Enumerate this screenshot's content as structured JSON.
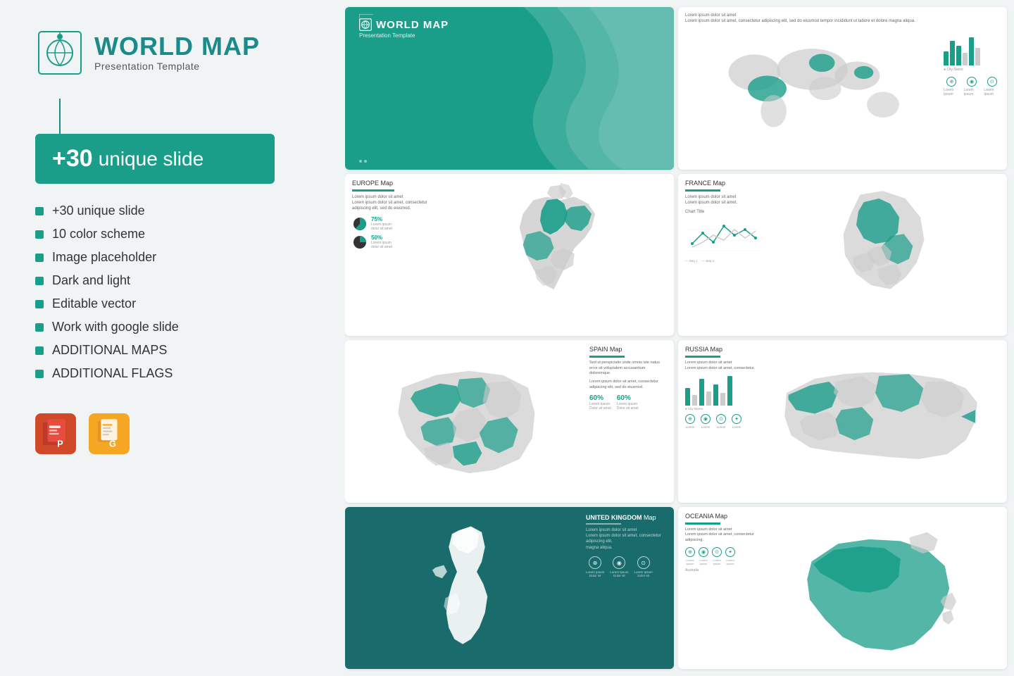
{
  "brand": {
    "title": "WORLD MAP",
    "subtitle": "Presentation Template"
  },
  "badge": {
    "number": "+30",
    "label": "unique slide"
  },
  "features": [
    "+30 unique slide",
    "10 color scheme",
    "Image placeholder",
    "Dark and light",
    "Editable vector",
    "Work with google slide",
    "ADDITIONAL MAPS",
    "ADDITIONAL FLAGS"
  ],
  "slides": {
    "cover": {
      "title": "WORLD MAP",
      "subtitle": "Presentation Template"
    },
    "europe": {
      "label": "EUROPE",
      "suffix": " Map"
    },
    "france": {
      "label": "FRANCE",
      "suffix": " Map"
    },
    "spain": {
      "label": "SPAIN",
      "suffix": " Map"
    },
    "russia": {
      "label": "RUSSIA",
      "suffix": " Map"
    },
    "uk": {
      "label": "UNITED KINGDOM",
      "suffix": " Map"
    },
    "oceania": {
      "label": "OCEANIA",
      "suffix": " Map"
    }
  },
  "colors": {
    "primary": "#1a9e8a",
    "dark": "#1a6b6b",
    "gray": "#cccccc",
    "white": "#ffffff",
    "text": "#333333"
  }
}
